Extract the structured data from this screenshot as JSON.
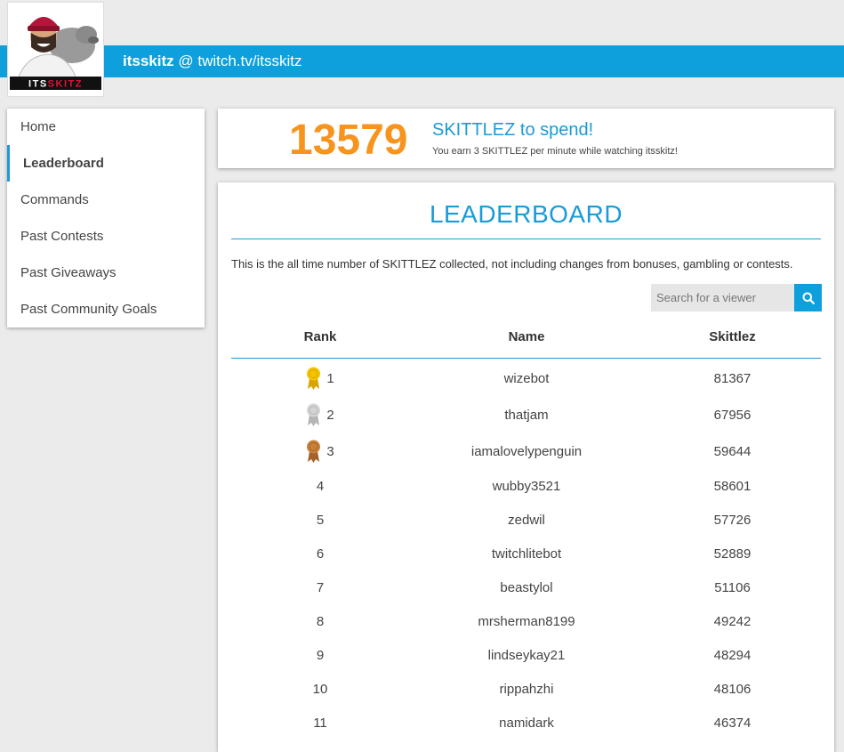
{
  "header": {
    "channel_name": "itsskitz",
    "channel_link": "@ twitch.tv/itsskitz",
    "logo_text": "ITSSKITZ"
  },
  "sidebar": {
    "items": [
      {
        "label": "Home"
      },
      {
        "label": "Leaderboard"
      },
      {
        "label": "Commands"
      },
      {
        "label": "Past Contests"
      },
      {
        "label": "Past Giveaways"
      },
      {
        "label": "Past Community Goals"
      }
    ],
    "active": "Leaderboard"
  },
  "points": {
    "value": "13579",
    "title": "SKITTLEZ to spend!",
    "subtitle": "You earn 3 SKITTLEZ per minute while watching itsskitz!"
  },
  "leaderboard": {
    "title": "LEADERBOARD",
    "description": "This is the all time number of SKITTLEZ collected, not including changes from bonuses, gambling or contests.",
    "search_placeholder": "Search for a viewer",
    "columns": {
      "rank": "Rank",
      "name": "Name",
      "points": "Skittlez"
    },
    "rows": [
      {
        "rank": "1",
        "name": "wizebot",
        "points": "81367",
        "medal": "gold"
      },
      {
        "rank": "2",
        "name": "thatjam",
        "points": "67956",
        "medal": "silver"
      },
      {
        "rank": "3",
        "name": "iamalovelypenguin",
        "points": "59644",
        "medal": "bronze"
      },
      {
        "rank": "4",
        "name": "wubby3521",
        "points": "58601"
      },
      {
        "rank": "5",
        "name": "zedwil",
        "points": "57726"
      },
      {
        "rank": "6",
        "name": "twitchlitebot",
        "points": "52889"
      },
      {
        "rank": "7",
        "name": "beastylol",
        "points": "51106"
      },
      {
        "rank": "8",
        "name": "mrsherman8199",
        "points": "49242"
      },
      {
        "rank": "9",
        "name": "lindseykay21",
        "points": "48294"
      },
      {
        "rank": "10",
        "name": "rippahzhi",
        "points": "48106"
      },
      {
        "rank": "11",
        "name": "namidark",
        "points": "46374"
      }
    ]
  },
  "colors": {
    "accent": "#1a9bd7",
    "header_bar": "#0ea0dc",
    "points": "#f7941d",
    "gold": "#f5c400",
    "silver": "#d4d4d4",
    "bronze": "#c8813a"
  }
}
